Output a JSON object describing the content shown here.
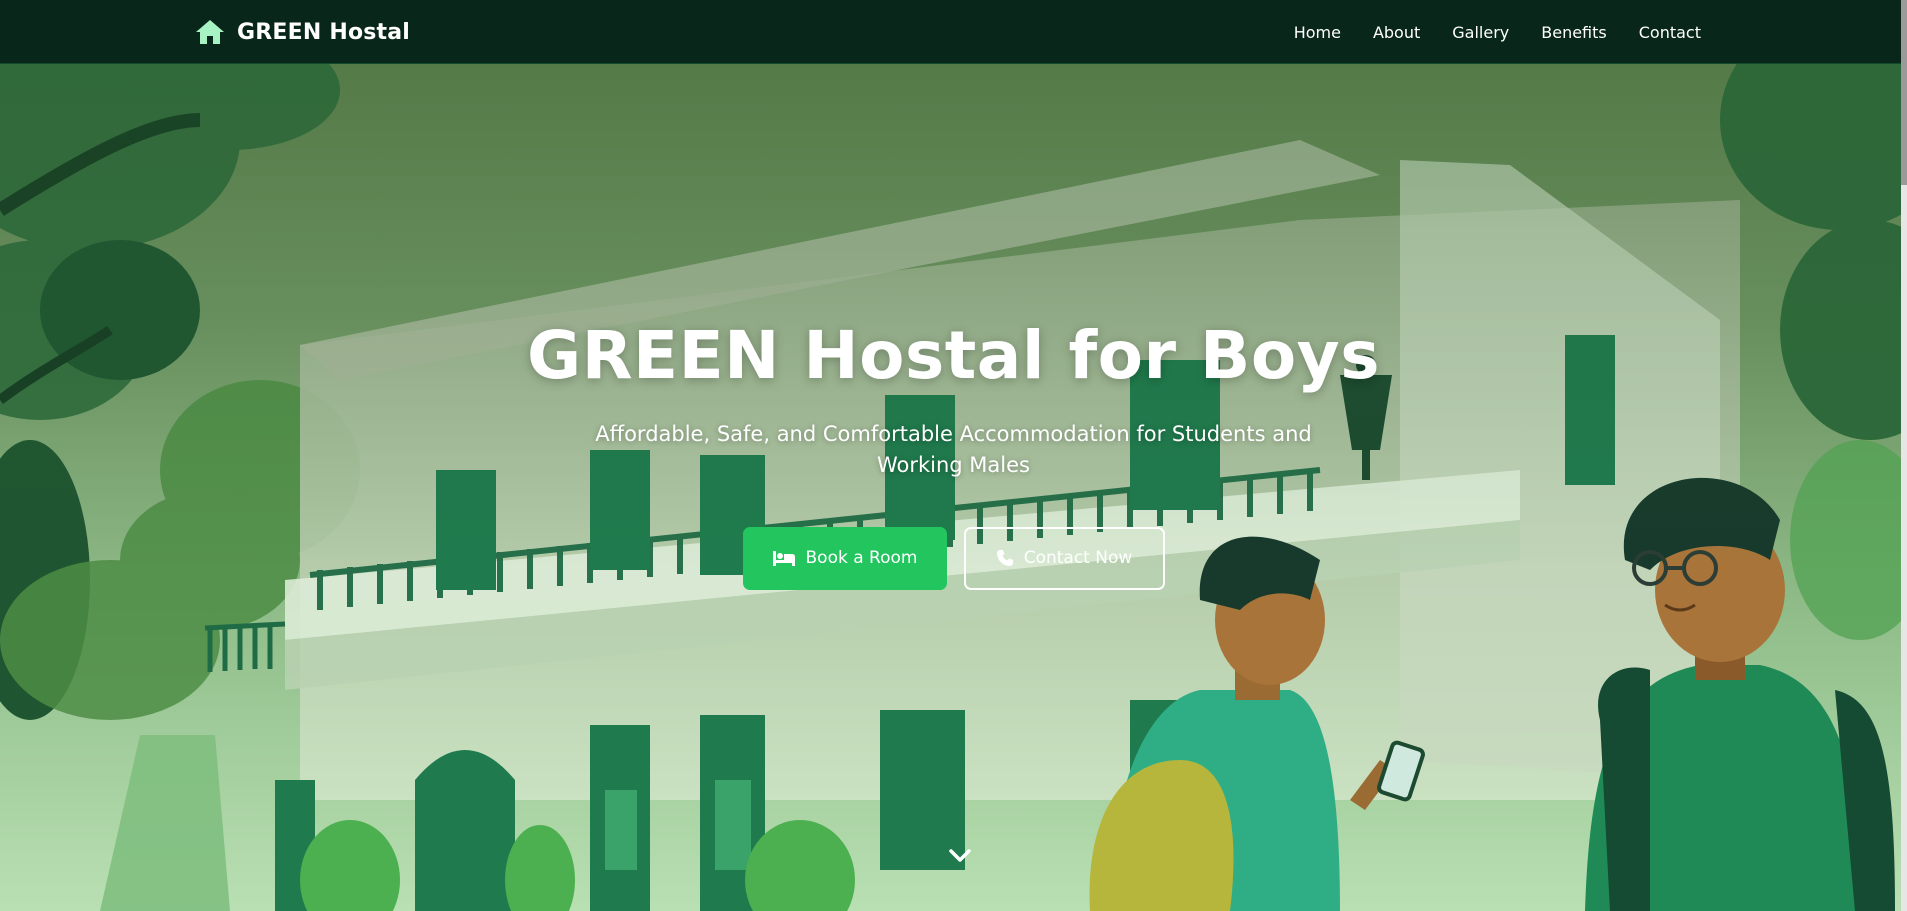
{
  "navbar": {
    "brand_name": "GREEN Hostal",
    "brand_icon": "home-icon",
    "links": [
      {
        "label": "Home"
      },
      {
        "label": "About"
      },
      {
        "label": "Gallery"
      },
      {
        "label": "Benefits"
      },
      {
        "label": "Contact"
      }
    ]
  },
  "hero": {
    "title": "GREEN Hostal for Boys",
    "subtitle": "Affordable, Safe, and Comfortable Accommodation for Students and Working Males",
    "primary_button": {
      "label": "Book a Room",
      "icon": "bed-icon"
    },
    "secondary_button": {
      "label": "Contact Now",
      "icon": "phone-icon"
    },
    "scroll_icon": "chevron-down-icon"
  },
  "colors": {
    "navbar_bg": "#08261a",
    "accent": "#22c55e",
    "brand_icon": "#a7f3c4",
    "text_light": "#ffffff"
  }
}
